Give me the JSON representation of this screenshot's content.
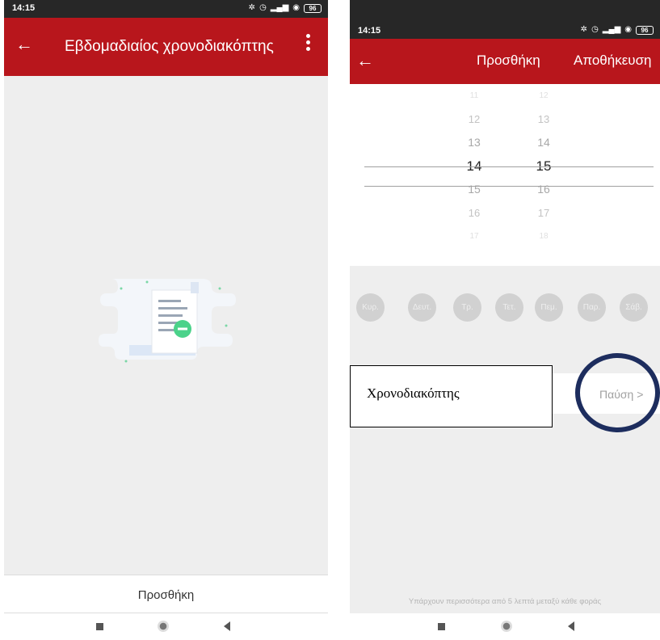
{
  "left_screen": {
    "status_time": "14:15",
    "battery": "96",
    "app_bar": {
      "title": "Εβδομαδιαίος χρονοδιακόπτης"
    },
    "empty_state_icon": "document-with-minus-icon",
    "bottom_button": "Προσθήκη"
  },
  "right_screen": {
    "status_time": "14:15",
    "battery": "96",
    "app_bar": {
      "title": "Προσθήκη",
      "save_label": "Αποθήκευση"
    },
    "hour_picker": [
      "11",
      "12",
      "13",
      "14",
      "15",
      "16",
      "17"
    ],
    "minute_picker": [
      "12",
      "13",
      "14",
      "15",
      "16",
      "17",
      "18"
    ],
    "selected_hour": "14",
    "selected_minute": "15",
    "days": [
      "Κυρ.",
      "Δευτ.",
      "Τρ.",
      "Τετ.",
      "Πεμ.",
      "Παρ.",
      "Σάβ."
    ],
    "timer_value": "Παύση",
    "info_text": "Υπάρχουν περισσότερα από 5 λεπτά μεταξύ κάθε φοράς"
  },
  "callout_label": "Χρονοδιακόπτης",
  "colors": {
    "app_bar": "#b8161c",
    "background": "#eeeeee",
    "day_chip": "#d1d1d1",
    "highlight_circle": "#1d2d5e"
  }
}
